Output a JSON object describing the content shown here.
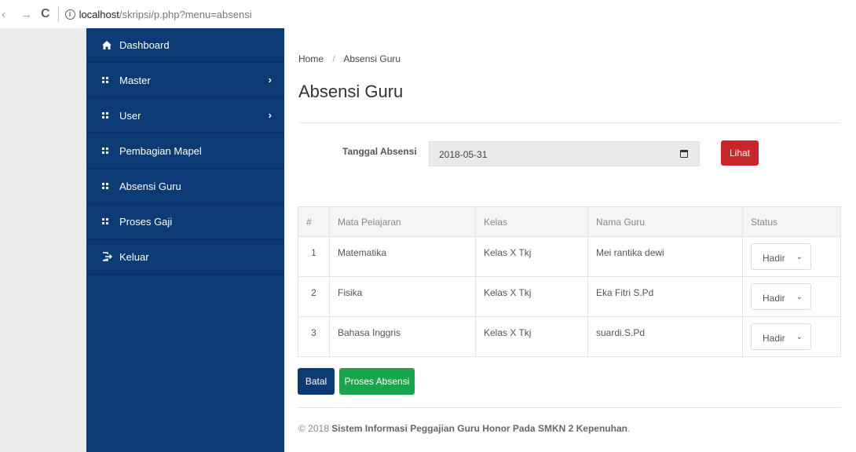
{
  "browser": {
    "url_host": "localhost",
    "url_path": "/skripsi/p.php?menu=absensi"
  },
  "sidebar": {
    "items": [
      {
        "label": "Dashboard",
        "icon": "home-icon"
      },
      {
        "label": "Master",
        "icon": "grid-icon",
        "has_submenu": true
      },
      {
        "label": "User",
        "icon": "grid-icon",
        "has_submenu": true
      },
      {
        "label": "Pembagian Mapel",
        "icon": "grid-icon"
      },
      {
        "label": "Absensi Guru",
        "icon": "grid-icon"
      },
      {
        "label": "Proses Gaji",
        "icon": "grid-icon"
      },
      {
        "label": "Keluar",
        "icon": "logout-icon"
      }
    ]
  },
  "breadcrumb": {
    "home": "Home",
    "separator": "/",
    "current": "Absensi Guru"
  },
  "page": {
    "title": "Absensi Guru"
  },
  "form": {
    "date_label": "Tanggal Absensi",
    "date_value": "2018-05-31",
    "view_button": "Lihat"
  },
  "table": {
    "headers": [
      "#",
      "Mata Pelajaran",
      "Kelas",
      "Nama Guru",
      "Status"
    ],
    "rows": [
      {
        "no": "1",
        "mapel": "Matematika",
        "kelas": "Kelas X Tkj",
        "guru": "Mei rantika dewi",
        "status": "Hadir"
      },
      {
        "no": "2",
        "mapel": "Fisika",
        "kelas": "Kelas X Tkj",
        "guru": "Eka Fitri S.Pd",
        "status": "Hadir"
      },
      {
        "no": "3",
        "mapel": "Bahasa Inggris",
        "kelas": "Kelas X Tkj",
        "guru": "suardi.S.Pd",
        "status": "Hadir"
      }
    ]
  },
  "actions": {
    "cancel": "Batal",
    "process": "Proses Absensi"
  },
  "footer": {
    "prefix": "© 2018",
    "text": "Sistem Informasi Peggajian Guru Honor Pada SMKN 2 Kepenuhan",
    "suffix": "."
  },
  "colors": {
    "sidebar": "#0c3a75",
    "danger": "#c9252b",
    "success": "#19a54a"
  }
}
